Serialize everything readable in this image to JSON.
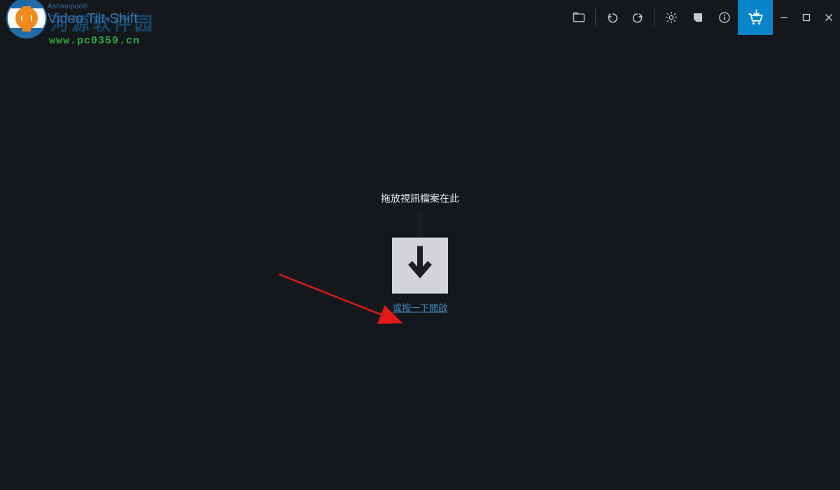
{
  "brand": {
    "vendor": "Ashampoo®",
    "title": "Video Tilt-Shift",
    "watermark_cn": "河源软件园",
    "watermark_url": "www.pc0359.cn"
  },
  "toolbar": {
    "open_icon": "folder-open-icon",
    "undo_icon": "undo-icon",
    "redo_icon": "redo-icon",
    "settings_icon": "gear-icon",
    "note_icon": "note-icon",
    "info_icon": "info-icon",
    "cart_icon": "cart-download-icon",
    "minimize_icon": "minimize-icon",
    "maximize_icon": "maximize-icon",
    "close_icon": "close-icon"
  },
  "droparea": {
    "hint": "拖放視訊檔案在此",
    "open_link": "或按一下開啟",
    "icon": "download-into-tray-icon"
  },
  "colors": {
    "bg": "#14181c",
    "accent": "#0a84c9",
    "link": "#3c8cb9",
    "watermark_green": "#2fa83f",
    "annotation_red": "#e11919"
  }
}
